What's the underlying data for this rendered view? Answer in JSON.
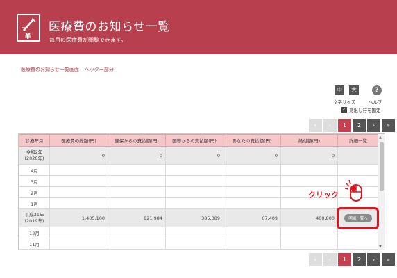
{
  "header": {
    "title": "医療費のお知らせ一覧",
    "subtitle": "毎月の医療費が閲覧できます。",
    "bg_color": "#b8404e"
  },
  "breadcrumb": [
    "医療費のお知らせ一覧画面",
    "ヘッダー部分"
  ],
  "controls": {
    "size_medium": "中",
    "size_large": "大",
    "font_size_label": "文字サイズ",
    "help_symbol": "?",
    "help_label": "ヘルプ",
    "fix_header_label": "見出し行を固定",
    "fix_header_checked": true
  },
  "pagination": {
    "first": "«",
    "prev": "‹",
    "pages": [
      "1",
      "2"
    ],
    "current": "1",
    "next": "›",
    "last": "»"
  },
  "table": {
    "headers": [
      "診療年月",
      "医療費の総額(円)",
      "健保からの支払額(円)",
      "国等からの支払額(円)",
      "あなたの支払額(円)",
      "給付額(円)",
      "詳細一覧"
    ],
    "rows": [
      {
        "ym1": "令和2年",
        "ym2": "(2020年)",
        "total": "0",
        "kenpo": "0",
        "kuni": "0",
        "anata": "0",
        "kyufu": "0",
        "detail": ""
      },
      {
        "ym1": "4月",
        "ym2": "",
        "total": "",
        "kenpo": "",
        "kuni": "",
        "anata": "",
        "kyufu": "",
        "detail": ""
      },
      {
        "ym1": "3月",
        "ym2": "",
        "total": "",
        "kenpo": "",
        "kuni": "",
        "anata": "",
        "kyufu": "",
        "detail": ""
      },
      {
        "ym1": "2月",
        "ym2": "",
        "total": "",
        "kenpo": "",
        "kuni": "",
        "anata": "",
        "kyufu": "",
        "detail": ""
      },
      {
        "ym1": "1月",
        "ym2": "",
        "total": "",
        "kenpo": "",
        "kuni": "",
        "anata": "",
        "kyufu": "",
        "detail": ""
      },
      {
        "ym1": "平成31年",
        "ym2": "(2019年)",
        "total": "1,405,100",
        "kenpo": "821,984",
        "kuni": "385,089",
        "anata": "67,409",
        "kyufu": "400,800",
        "detail": "明細一覧へ"
      },
      {
        "ym1": "12月",
        "ym2": "",
        "total": "",
        "kenpo": "",
        "kuni": "",
        "anata": "",
        "kyufu": "",
        "detail": ""
      },
      {
        "ym1": "11月",
        "ym2": "",
        "total": "",
        "kenpo": "",
        "kuni": "",
        "anata": "",
        "kyufu": "",
        "detail": ""
      }
    ]
  },
  "annotation": {
    "click_label": "クリック",
    "highlight_color": "#e0141e"
  }
}
